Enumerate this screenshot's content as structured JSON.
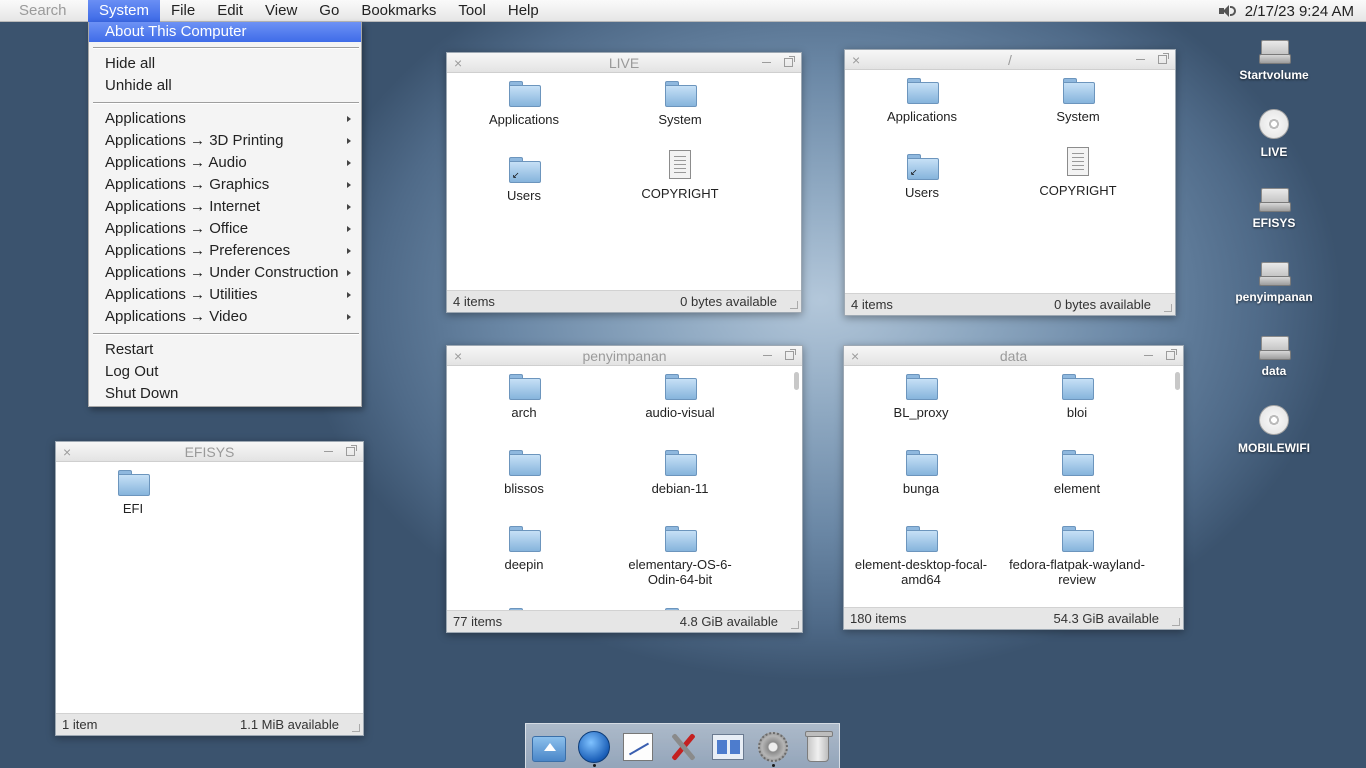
{
  "menubar": {
    "search_placeholder": "Search",
    "menus": [
      "System",
      "File",
      "Edit",
      "View",
      "Go",
      "Bookmarks",
      "Tool",
      "Help"
    ],
    "active_menu": "System",
    "clock": "2/17/23 9:24 AM"
  },
  "system_menu": {
    "about": "About This Computer",
    "hide_all": "Hide all",
    "unhide_all": "Unhide all",
    "applications": [
      "Applications",
      "Applications → 3D Printing",
      "Applications → Audio",
      "Applications → Graphics",
      "Applications → Internet",
      "Applications → Office",
      "Applications → Preferences",
      "Applications → Under Construction",
      "Applications → Utilities",
      "Applications → Video"
    ],
    "restart": "Restart",
    "log_out": "Log Out",
    "shut_down": "Shut Down"
  },
  "windows": {
    "live": {
      "title": "LIVE",
      "items": [
        "Applications",
        "System",
        "Users",
        "COPYRIGHT"
      ],
      "status_count": "4 items",
      "status_space": "0 bytes available"
    },
    "root": {
      "title": "/",
      "items": [
        "Applications",
        "System",
        "Users",
        "COPYRIGHT"
      ],
      "status_count": "4 items",
      "status_space": "0 bytes available"
    },
    "efisys": {
      "title": "EFISYS",
      "items": [
        "EFI"
      ],
      "status_count": "1 item",
      "status_space": "1.1 MiB available"
    },
    "penyimpanan": {
      "title": "penyimpanan",
      "items": [
        "arch",
        "audio-visual",
        "blissos",
        "debian-11",
        "deepin",
        "elementary-OS-6-Odin-64-bit"
      ],
      "status_count": "77 items",
      "status_space": "4.8 GiB available"
    },
    "data": {
      "title": "data",
      "items": [
        "BL_proxy",
        "bloi",
        "bunga",
        "element",
        "element-desktop-focal-amd64",
        "fedora-flatpak-wayland-review"
      ],
      "status_count": "180 items",
      "status_space": "54.3 GiB available"
    }
  },
  "desktop_icons": [
    "Startvolume",
    "LIVE",
    "EFISYS",
    "penyimpanan",
    "data",
    "MOBILEWIFI"
  ],
  "desktop_icon_types": [
    "hdd-icon",
    "cd-icon",
    "hdd-icon",
    "hdd-icon",
    "hdd-icon",
    "cd-icon"
  ],
  "dock_icons": [
    "home-folder-icon",
    "web-browser-icon",
    "text-editor-icon",
    "tools-icon",
    "panel-icon",
    "settings-gear-icon",
    "trash-icon"
  ],
  "colors": {
    "menu_highlight": "#3f6ce8",
    "folder_blue": "#86b4dc"
  }
}
